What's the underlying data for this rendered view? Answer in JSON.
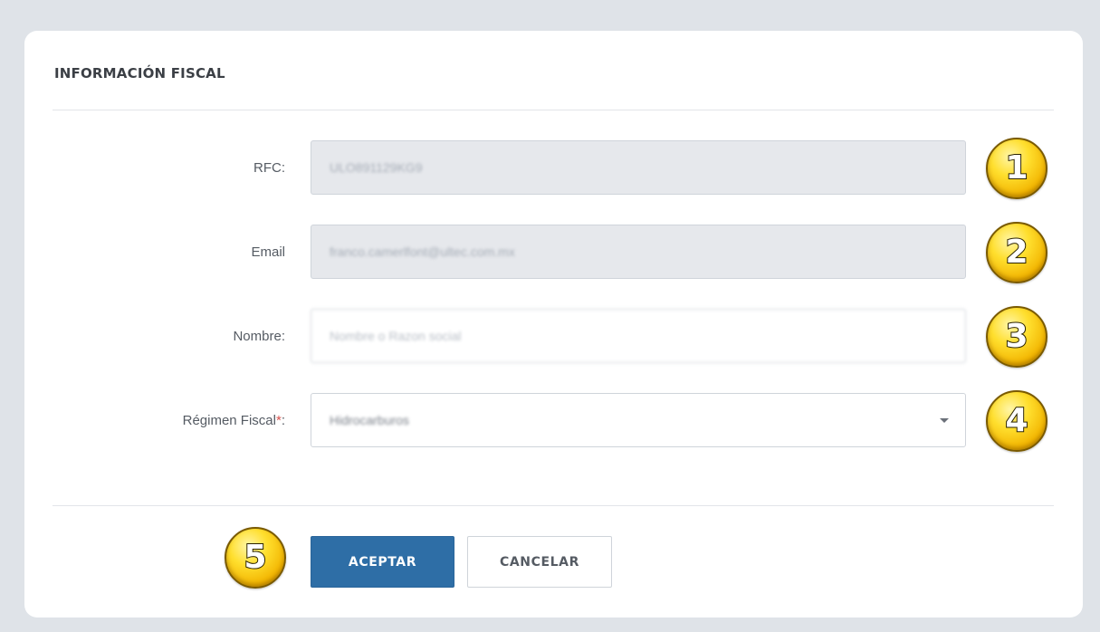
{
  "form": {
    "title": "INFORMACIÓN FISCAL",
    "rfc": {
      "label": "RFC:",
      "value": "ULO891129KG9"
    },
    "email": {
      "label": "Email",
      "value": "franco.camerlfont@ultec.com.mx"
    },
    "nombre": {
      "label": "Nombre:",
      "placeholder": "Nombre o Razon social"
    },
    "regimen": {
      "label": "Régimen Fiscal",
      "required_mark": "*",
      "label_suffix": ":",
      "selected": "Hidrocarburos"
    }
  },
  "actions": {
    "accept_label": "ACEPTAR",
    "cancel_label": "CANCELAR"
  },
  "badges": [
    "1",
    "2",
    "3",
    "4",
    "5"
  ],
  "colors": {
    "primary": "#2e6ea6",
    "required": "#d9534f",
    "badge": "#f2b400"
  }
}
